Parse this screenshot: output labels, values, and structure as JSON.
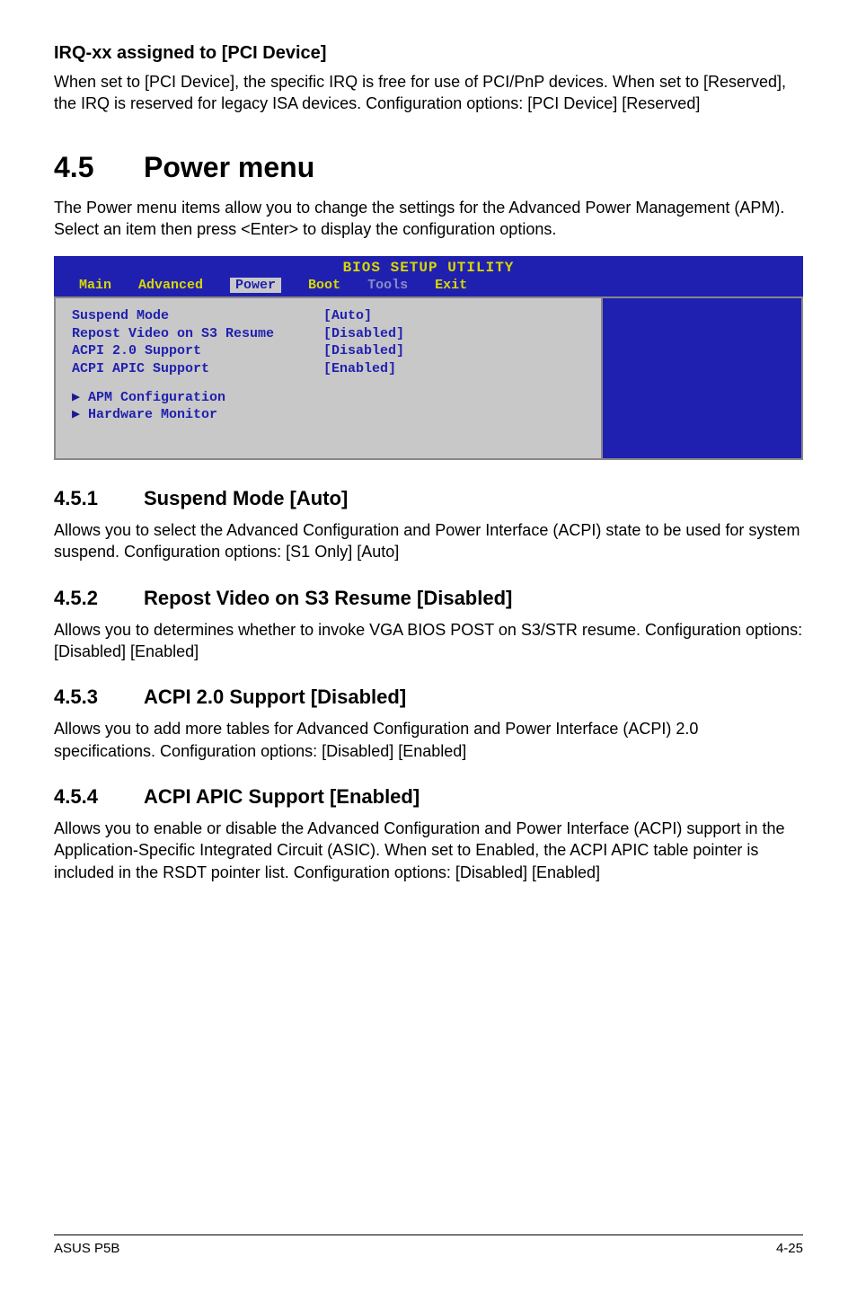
{
  "section_irq": {
    "heading": "IRQ-xx assigned to [PCI Device]",
    "body": "When set to [PCI Device], the specific IRQ is free for use of PCI/PnP devices. When set to [Reserved], the IRQ is reserved for legacy ISA devices. Configuration options: [PCI Device] [Reserved]"
  },
  "section_4_5": {
    "num": "4.5",
    "title": "Power menu",
    "intro": "The Power menu items allow you to change the settings for the Advanced Power Management (APM). Select an item then press <Enter> to display the configuration options."
  },
  "bios": {
    "title": "BIOS SETUP UTILITY",
    "tabs": {
      "main": "Main",
      "advanced": "Advanced",
      "power": "Power",
      "boot": "Boot",
      "tools": "Tools",
      "exit": "Exit"
    },
    "rows": [
      {
        "label": "Suspend Mode",
        "value": "[Auto]"
      },
      {
        "label": "Repost Video on S3 Resume",
        "value": "[Disabled]"
      },
      {
        "label": "ACPI 2.0 Support",
        "value": "[Disabled]"
      },
      {
        "label": "ACPI APIC Support",
        "value": "[Enabled]"
      }
    ],
    "submenu": [
      "APM Configuration",
      "Hardware Monitor"
    ]
  },
  "sub_4_5_1": {
    "num": "4.5.1",
    "title": "Suspend Mode [Auto]",
    "body": "Allows you to select the Advanced Configuration and Power Interface (ACPI) state to be used for system suspend. Configuration options: [S1 Only] [Auto]"
  },
  "sub_4_5_2": {
    "num": "4.5.2",
    "title": "Repost Video on S3 Resume [Disabled]",
    "body": "Allows you to determines whether to invoke VGA BIOS POST on S3/STR resume. Configuration options: [Disabled] [Enabled]"
  },
  "sub_4_5_3": {
    "num": "4.5.3",
    "title": "ACPI 2.0 Support [Disabled]",
    "body": "Allows you to add more tables for Advanced Configuration and Power Interface (ACPI) 2.0 specifications. Configuration options: [Disabled] [Enabled]"
  },
  "sub_4_5_4": {
    "num": "4.5.4",
    "title": "ACPI APIC Support [Enabled]",
    "body": "Allows you to enable or disable the Advanced Configuration and Power Interface (ACPI) support in the Application-Specific Integrated Circuit (ASIC). When set to Enabled, the ACPI APIC table pointer is included in the RSDT pointer list. Configuration options: [Disabled] [Enabled]"
  },
  "footer": {
    "left": "ASUS P5B",
    "right": "4-25"
  }
}
